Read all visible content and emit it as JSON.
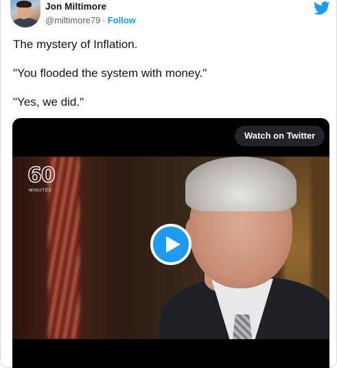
{
  "author": {
    "name": "Jon Miltimore",
    "handle": "@miltimore79",
    "separator": "·",
    "follow_label": "Follow"
  },
  "tweet": {
    "lines": [
      "The mystery of Inflation.",
      "\"You flooded the system with money.\"",
      "\"Yes, we did.\""
    ]
  },
  "video": {
    "watch_label": "Watch on Twitter",
    "logo_number": "60",
    "logo_word": "MINUTES"
  },
  "icons": {
    "brand": "twitter-bird-icon",
    "play": "play-icon"
  },
  "colors": {
    "accent": "#1d9bf0",
    "text": "#0f1419",
    "muted": "#536471"
  }
}
